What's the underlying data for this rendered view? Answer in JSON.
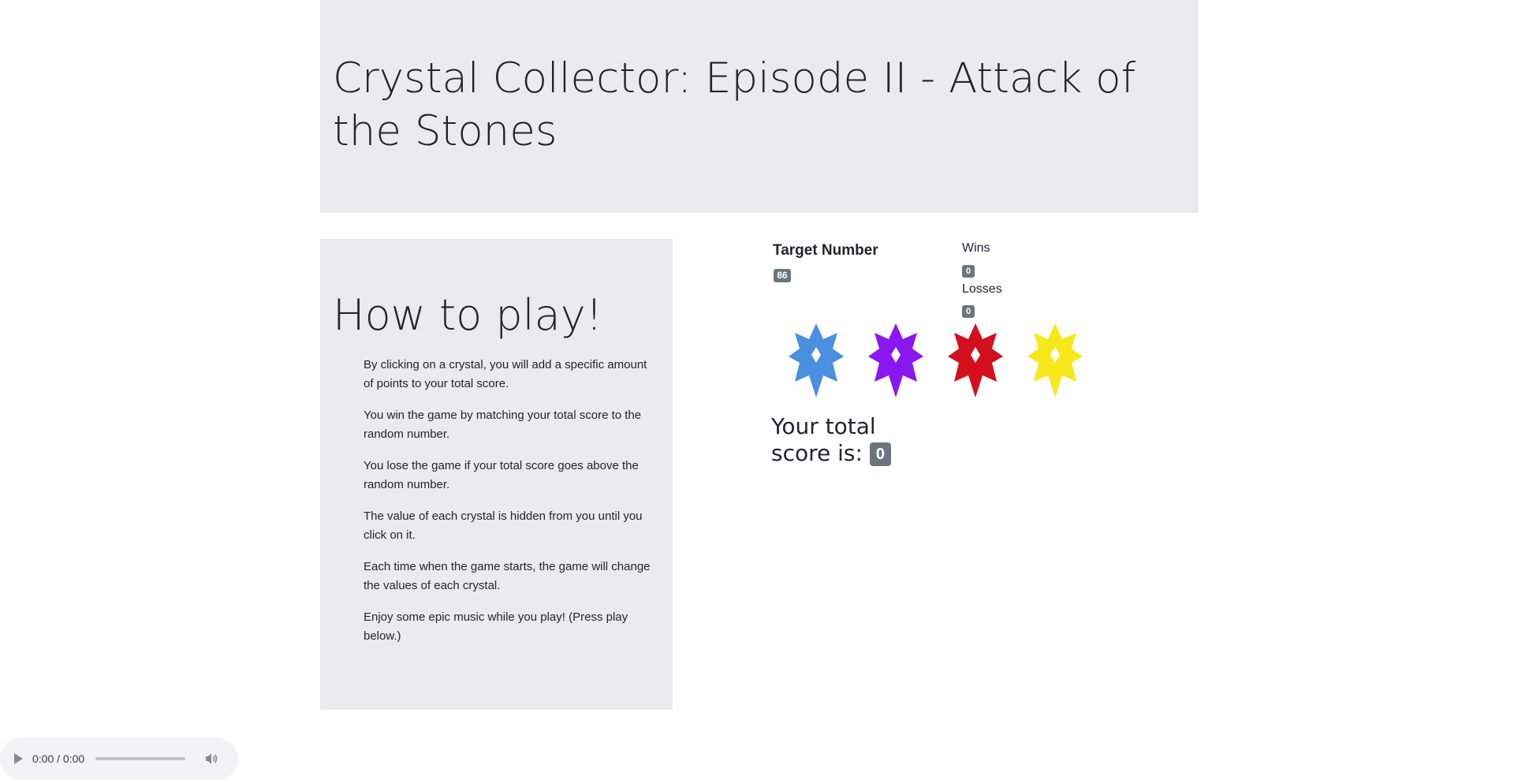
{
  "header": {
    "title": "Crystal Collector: Episode II - Attack of the Stones"
  },
  "instructions": {
    "heading": "How to play!",
    "items": [
      "By clicking on a crystal, you will add a specific amount of points to your total score.",
      "You win the game by matching your total score to the random number.",
      "You lose the game if your total score goes above the random number.",
      "The value of each crystal is hidden from you until you click on it.",
      "Each time when the game starts, the game will change the values of each crystal.",
      "Enjoy some epic music while you play! (Press play below.)"
    ]
  },
  "game": {
    "target_label": "Target Number",
    "target_value": "86",
    "wins_label": "Wins",
    "wins_value": "0",
    "losses_label": "Losses",
    "losses_value": "0",
    "score_label": "Your total score is:",
    "score_value": "0",
    "crystals": [
      {
        "name": "blue-crystal",
        "color": "#4a8fe0"
      },
      {
        "name": "purple-crystal",
        "color": "#8a17f0"
      },
      {
        "name": "red-crystal",
        "color": "#d4101e"
      },
      {
        "name": "yellow-crystal",
        "color": "#f7e81c"
      }
    ]
  },
  "audio": {
    "time": "0:00 / 0:00",
    "icons": [
      "play-icon",
      "volume-icon"
    ]
  }
}
